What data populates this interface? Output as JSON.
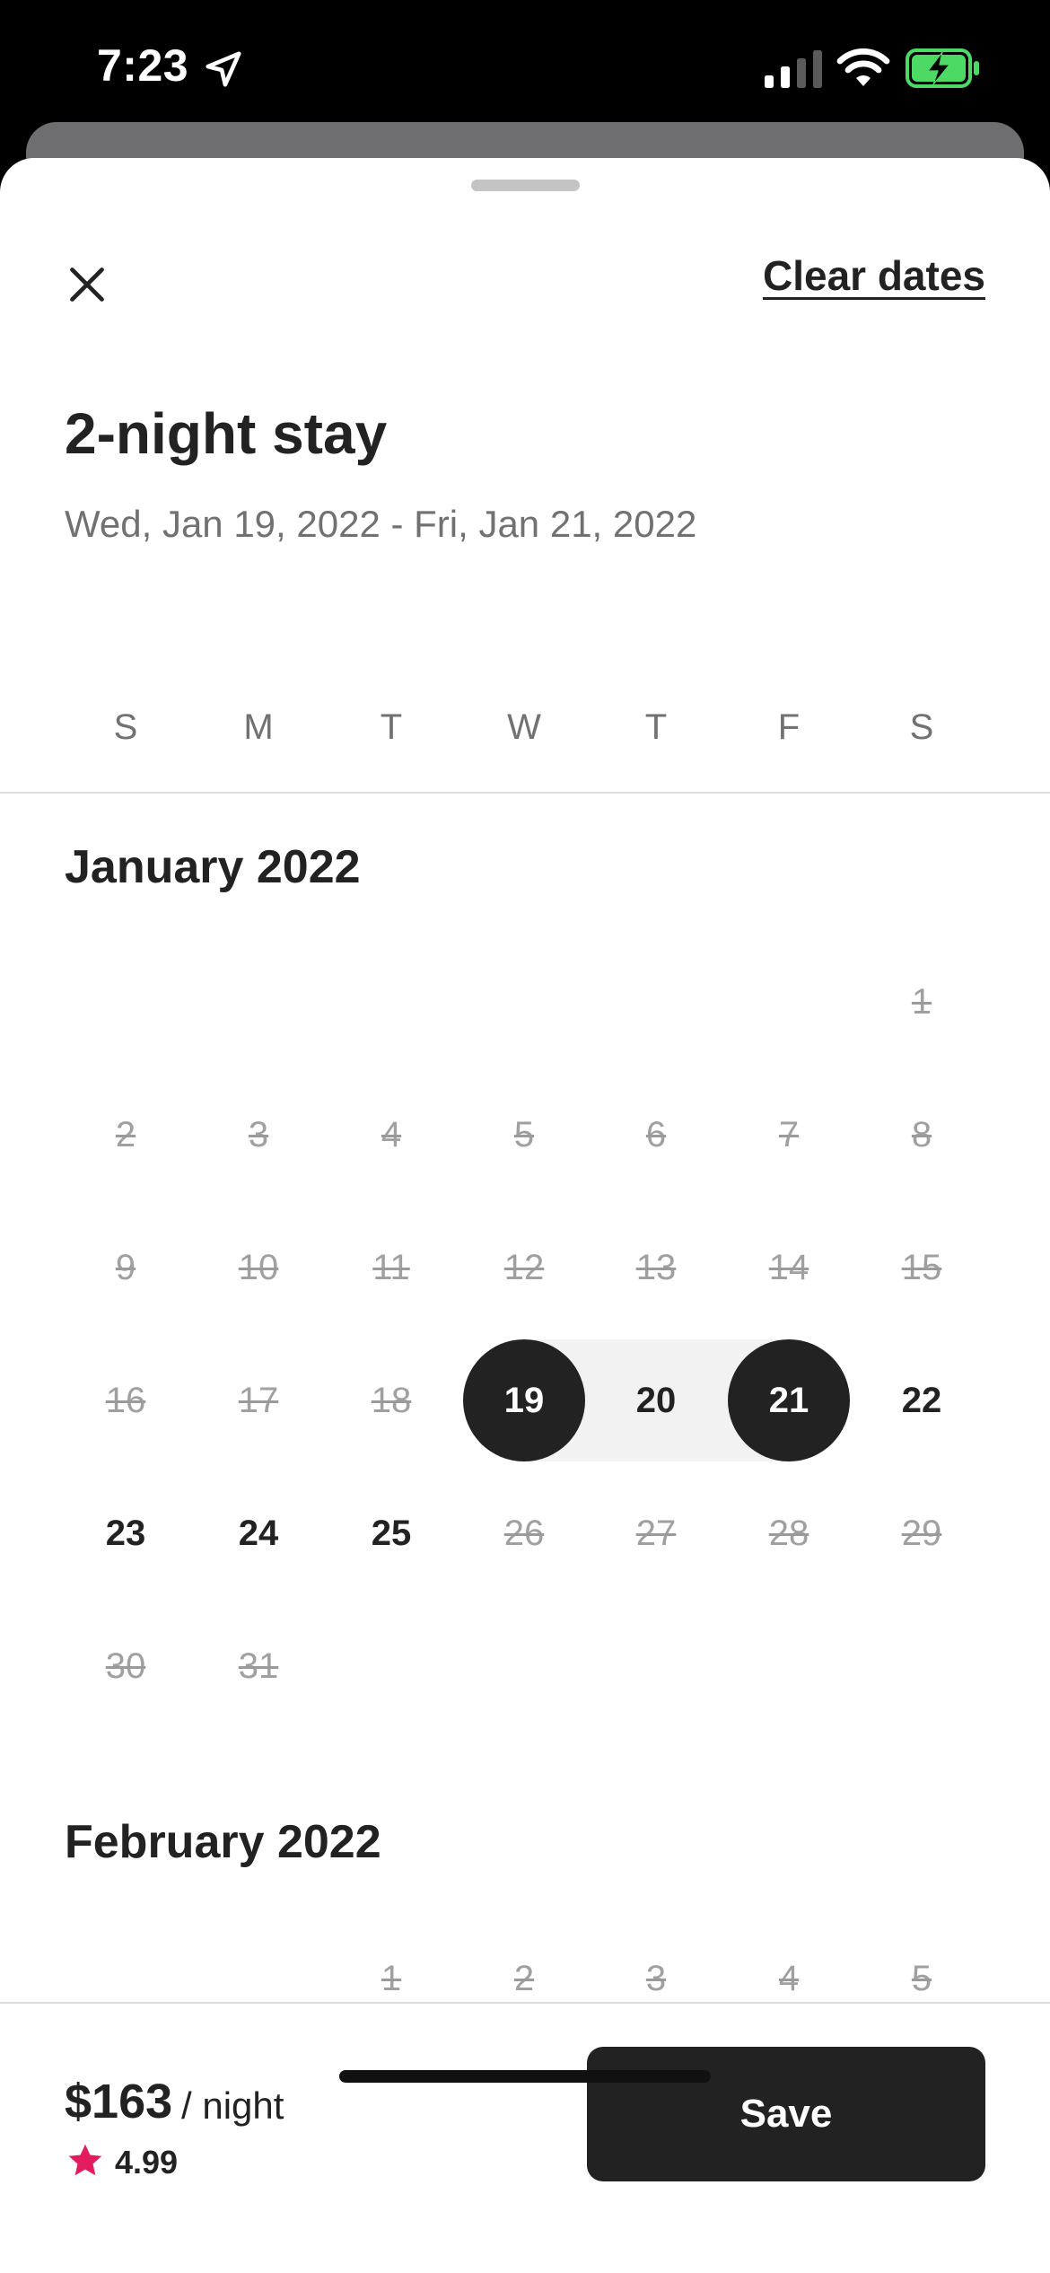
{
  "status_bar": {
    "time": "7:23",
    "icons": [
      "location-arrow-icon",
      "cellular-signal-icon",
      "wifi-icon",
      "battery-charging-icon"
    ]
  },
  "header": {
    "close_icon": "close-icon",
    "clear_dates_label": "Clear dates"
  },
  "stay": {
    "title": "2-night stay",
    "range": "Wed, Jan 19, 2022 - Fri, Jan 21, 2022"
  },
  "weekdays": [
    "S",
    "M",
    "T",
    "W",
    "T",
    "F",
    "S"
  ],
  "months": [
    {
      "title": "January 2022",
      "weeks": [
        [
          null,
          null,
          null,
          null,
          null,
          null,
          {
            "day": "1",
            "state": "blocked"
          }
        ],
        [
          {
            "day": "2",
            "state": "blocked"
          },
          {
            "day": "3",
            "state": "blocked"
          },
          {
            "day": "4",
            "state": "blocked"
          },
          {
            "day": "5",
            "state": "blocked"
          },
          {
            "day": "6",
            "state": "blocked"
          },
          {
            "day": "7",
            "state": "blocked"
          },
          {
            "day": "8",
            "state": "blocked"
          }
        ],
        [
          {
            "day": "9",
            "state": "blocked"
          },
          {
            "day": "10",
            "state": "blocked"
          },
          {
            "day": "11",
            "state": "blocked"
          },
          {
            "day": "12",
            "state": "blocked"
          },
          {
            "day": "13",
            "state": "blocked"
          },
          {
            "day": "14",
            "state": "blocked"
          },
          {
            "day": "15",
            "state": "blocked"
          }
        ],
        [
          {
            "day": "16",
            "state": "blocked"
          },
          {
            "day": "17",
            "state": "blocked"
          },
          {
            "day": "18",
            "state": "blocked"
          },
          {
            "day": "19",
            "state": "selected"
          },
          {
            "day": "20",
            "state": "in-range"
          },
          {
            "day": "21",
            "state": "selected"
          },
          {
            "day": "22",
            "state": "available"
          }
        ],
        [
          {
            "day": "23",
            "state": "available"
          },
          {
            "day": "24",
            "state": "available"
          },
          {
            "day": "25",
            "state": "available"
          },
          {
            "day": "26",
            "state": "blocked"
          },
          {
            "day": "27",
            "state": "blocked"
          },
          {
            "day": "28",
            "state": "blocked"
          },
          {
            "day": "29",
            "state": "blocked"
          }
        ],
        [
          {
            "day": "30",
            "state": "blocked"
          },
          {
            "day": "31",
            "state": "blocked"
          },
          null,
          null,
          null,
          null,
          null
        ]
      ]
    },
    {
      "title": "February 2022",
      "weeks": [
        [
          null,
          null,
          {
            "day": "1",
            "state": "blocked"
          },
          {
            "day": "2",
            "state": "blocked"
          },
          {
            "day": "3",
            "state": "blocked"
          },
          {
            "day": "4",
            "state": "blocked"
          },
          {
            "day": "5",
            "state": "blocked"
          }
        ]
      ]
    }
  ],
  "footer": {
    "price": "$163",
    "per_night": "/ night",
    "rating": "4.99",
    "star_color": "#E31C5F",
    "save_label": "Save"
  }
}
